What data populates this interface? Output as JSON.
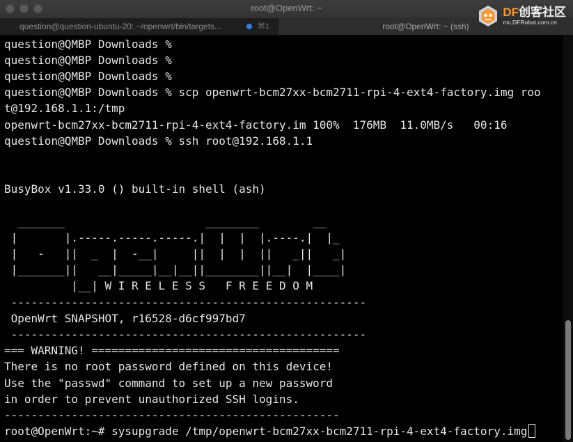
{
  "window": {
    "title": "root@OpenWrt: ~"
  },
  "tabs": [
    {
      "label": "question@question-ubuntu-20: ~/openwrt/bin/targets...",
      "shortcut": "⌘1"
    },
    {
      "label": "root@OpenWrt: ~ (ssh)"
    }
  ],
  "watermark": {
    "brand_df": "DF",
    "brand_rest": "创客社区",
    "url": "mc.DFRobot.com.cn"
  },
  "terminal": {
    "lines": [
      "question@QMBP Downloads %",
      "question@QMBP Downloads %",
      "question@QMBP Downloads %",
      "question@QMBP Downloads % scp openwrt-bcm27xx-bcm2711-rpi-4-ext4-factory.img roo",
      "t@192.168.1.1:/tmp",
      "openwrt-bcm27xx-bcm2711-rpi-4-ext4-factory.im 100%  176MB  11.0MB/s   00:16",
      "question@QMBP Downloads % ssh root@192.168.1.1",
      "",
      "",
      "BusyBox v1.33.0 () built-in shell (ash)",
      "",
      "  _______                     ________        __",
      " |       |.-----.-----.-----.|  |  |  |.----.|  |_",
      " |   -   ||  _  |  -__|     ||  |  |  ||   _||   _|",
      " |_______||   __|_____|__|__||________||__|  |____|",
      "          |__| W I R E L E S S   F R E E D O M",
      " -----------------------------------------------------",
      " OpenWrt SNAPSHOT, r16528-d6cf997bd7",
      " -----------------------------------------------------",
      "=== WARNING! =====================================",
      "There is no root password defined on this device!",
      "Use the \"passwd\" command to set up a new password",
      "in order to prevent unauthorized SSH logins.",
      "--------------------------------------------------",
      "root@OpenWrt:~# sysupgrade /tmp/openwrt-bcm27xx-bcm2711-rpi-4-ext4-factory.img"
    ]
  },
  "colors": {
    "background": "#000000",
    "text": "#e6e6e6",
    "tab_indicator": "#3b7bdc",
    "brand_accent": "#f39a3b"
  }
}
